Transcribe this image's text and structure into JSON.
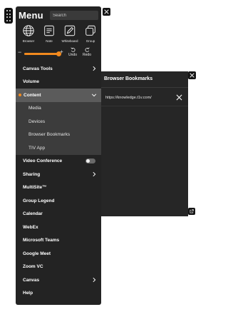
{
  "menu": {
    "title": "Menu",
    "search_placeholder": "Search",
    "tools": [
      {
        "label": "Browser",
        "icon": "globe-icon"
      },
      {
        "label": "Note",
        "icon": "note-icon"
      },
      {
        "label": "Whiteboard",
        "icon": "whiteboard-icon"
      },
      {
        "label": "Group",
        "icon": "group-icon"
      }
    ],
    "zoom": {
      "minus": "−",
      "plus": "+",
      "value_fraction": 1.0
    },
    "undo_label": "Undo",
    "redo_label": "Redo",
    "items_top": [
      {
        "label": "Canvas Tools",
        "chevron": "right"
      },
      {
        "label": "Volume"
      }
    ],
    "content": {
      "label": "Content",
      "chevron": "down",
      "subitems": [
        "Media",
        "Devices",
        "Browser Bookmarks",
        "TIV App"
      ]
    },
    "video_conference": {
      "label": "Video Conference",
      "toggle": "off"
    },
    "items_bottom": [
      {
        "label": "Sharing",
        "chevron": "right"
      },
      {
        "label": "MultiSite™"
      },
      {
        "label": "Group Legend"
      },
      {
        "label": "Calendar"
      },
      {
        "label": "WebEx"
      },
      {
        "label": "Microsoft Teams"
      },
      {
        "label": "Google Meet"
      },
      {
        "label": "Zoom VC"
      },
      {
        "label": "Canvas",
        "chevron": "right"
      },
      {
        "label": "Help"
      }
    ]
  },
  "bookmarks": {
    "title": "Browser Bookmarks",
    "items": [
      "https://knowledge.t1v.com/"
    ]
  },
  "colors": {
    "accent": "#f28a1e",
    "panel": "#232323",
    "active_item": "#5b5b5b",
    "submenu": "#3c3c3c"
  }
}
